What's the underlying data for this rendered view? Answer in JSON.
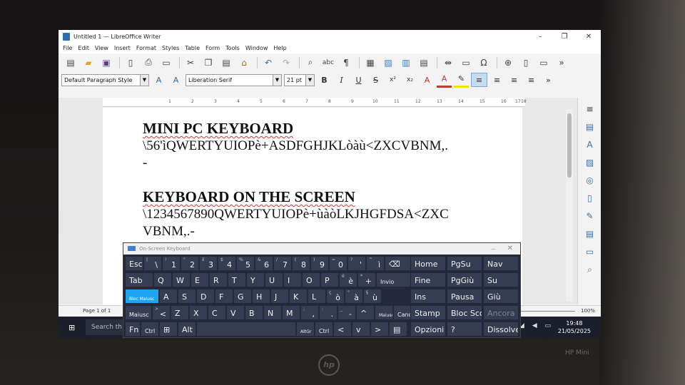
{
  "window": {
    "title": "Untitled 1 — LibreOffice Writer",
    "minimize": "–",
    "maximize": "❐",
    "close": "✕"
  },
  "menu": [
    "File",
    "Edit",
    "View",
    "Insert",
    "Format",
    "Styles",
    "Table",
    "Form",
    "Tools",
    "Window",
    "Help"
  ],
  "formatting": {
    "paragraph_style": "Default Paragraph Style",
    "font_name": "Liberation Serif",
    "font_size": "21 pt"
  },
  "ruler_ticks": [
    "1",
    "2",
    "3",
    "4",
    "5",
    "6",
    "7",
    "8",
    "9",
    "10",
    "11",
    "12",
    "13",
    "14",
    "15",
    "16",
    "17",
    "18"
  ],
  "document": {
    "heading1": "MINI PC KEYBOARD",
    "line1": "\\56'ìQWERTYUIOPè+ASDFGHJKLòàù<ZXCVBNM,.",
    "line2": "-",
    "heading2": "KEYBOARD ON THE SCREEN",
    "line3": "\\1234567890QWERTYUIOPè+ùàòLKJHGFDSA<ZXC",
    "line4": "VBNM,.-"
  },
  "statusbar": {
    "page": "Page 1 of 1",
    "zoom": "100%"
  },
  "osk": {
    "title": "On-Screen Keyboard",
    "row1": [
      {
        "main": "Esc"
      },
      {
        "sub": "|",
        "main": "\\"
      },
      {
        "sub": "!",
        "main": "1"
      },
      {
        "sub": "\"",
        "main": "2"
      },
      {
        "sub": "£",
        "main": "3"
      },
      {
        "sub": "$",
        "main": "4"
      },
      {
        "sub": "%",
        "main": "5"
      },
      {
        "sub": "&",
        "main": "6"
      },
      {
        "sub": "/",
        "main": "7"
      },
      {
        "sub": "(",
        "main": "8"
      },
      {
        "sub": ")",
        "main": "9"
      },
      {
        "sub": "=",
        "main": "0"
      },
      {
        "sub": "?",
        "main": "'"
      },
      {
        "sub": "^",
        "main": "ì"
      },
      {
        "main": "⌫"
      }
    ],
    "row2": [
      {
        "main": "Tab"
      },
      {
        "main": "Q"
      },
      {
        "main": "W"
      },
      {
        "main": "E"
      },
      {
        "main": "R"
      },
      {
        "main": "T"
      },
      {
        "main": "Y"
      },
      {
        "main": "U"
      },
      {
        "main": "I"
      },
      {
        "main": "O"
      },
      {
        "main": "P"
      },
      {
        "sub": "é",
        "main": "è"
      },
      {
        "sub": "*",
        "main": "+"
      },
      {
        "main": "Invio"
      }
    ],
    "row3": [
      {
        "main": "Bloc Maiusc"
      },
      {
        "main": "A"
      },
      {
        "main": "S"
      },
      {
        "main": "D"
      },
      {
        "main": "F"
      },
      {
        "main": "G"
      },
      {
        "main": "H"
      },
      {
        "main": "J"
      },
      {
        "main": "K"
      },
      {
        "main": "L"
      },
      {
        "sub": "ç",
        "main": "ò"
      },
      {
        "sub": "°",
        "main": "à"
      },
      {
        "sub": "§",
        "main": "ù"
      }
    ],
    "row4": [
      {
        "main": "Maiusc"
      },
      {
        "sub": ">",
        "main": "<"
      },
      {
        "main": "Z"
      },
      {
        "main": "X"
      },
      {
        "main": "C"
      },
      {
        "main": "V"
      },
      {
        "main": "B"
      },
      {
        "main": "N"
      },
      {
        "main": "M"
      },
      {
        "sub": ";",
        "main": ","
      },
      {
        "sub": ":",
        "main": "."
      },
      {
        "sub": "_",
        "main": "-"
      },
      {
        "main": "^"
      },
      {
        "main": "Maiusc"
      },
      {
        "main": "Canc"
      }
    ],
    "row5": [
      {
        "main": "Fn"
      },
      {
        "main": "Ctrl"
      },
      {
        "main": "⊞"
      },
      {
        "main": "Alt"
      },
      {
        "main": ""
      },
      {
        "main": "AltGr"
      },
      {
        "main": "Ctrl"
      },
      {
        "main": "<"
      },
      {
        "main": "v"
      },
      {
        "main": ">"
      },
      {
        "main": "▤"
      }
    ],
    "nav": [
      [
        "Home",
        "PgSu",
        "Nav"
      ],
      [
        "Fine",
        "PgGiù",
        "Su"
      ],
      [
        "Ins",
        "Pausa",
        "Giù"
      ],
      [
        "Stamp",
        "Bloc Scorr",
        "Ancora"
      ],
      [
        "Opzioni",
        "?",
        "Dissolvenza"
      ]
    ]
  },
  "taskbar": {
    "start": "⊞",
    "search": "Search th",
    "time": "19:48",
    "date": "21/05/2025",
    "tray": "◢ ◀ ▭"
  },
  "device": {
    "brand": "hp",
    "model": "HP Mini"
  }
}
